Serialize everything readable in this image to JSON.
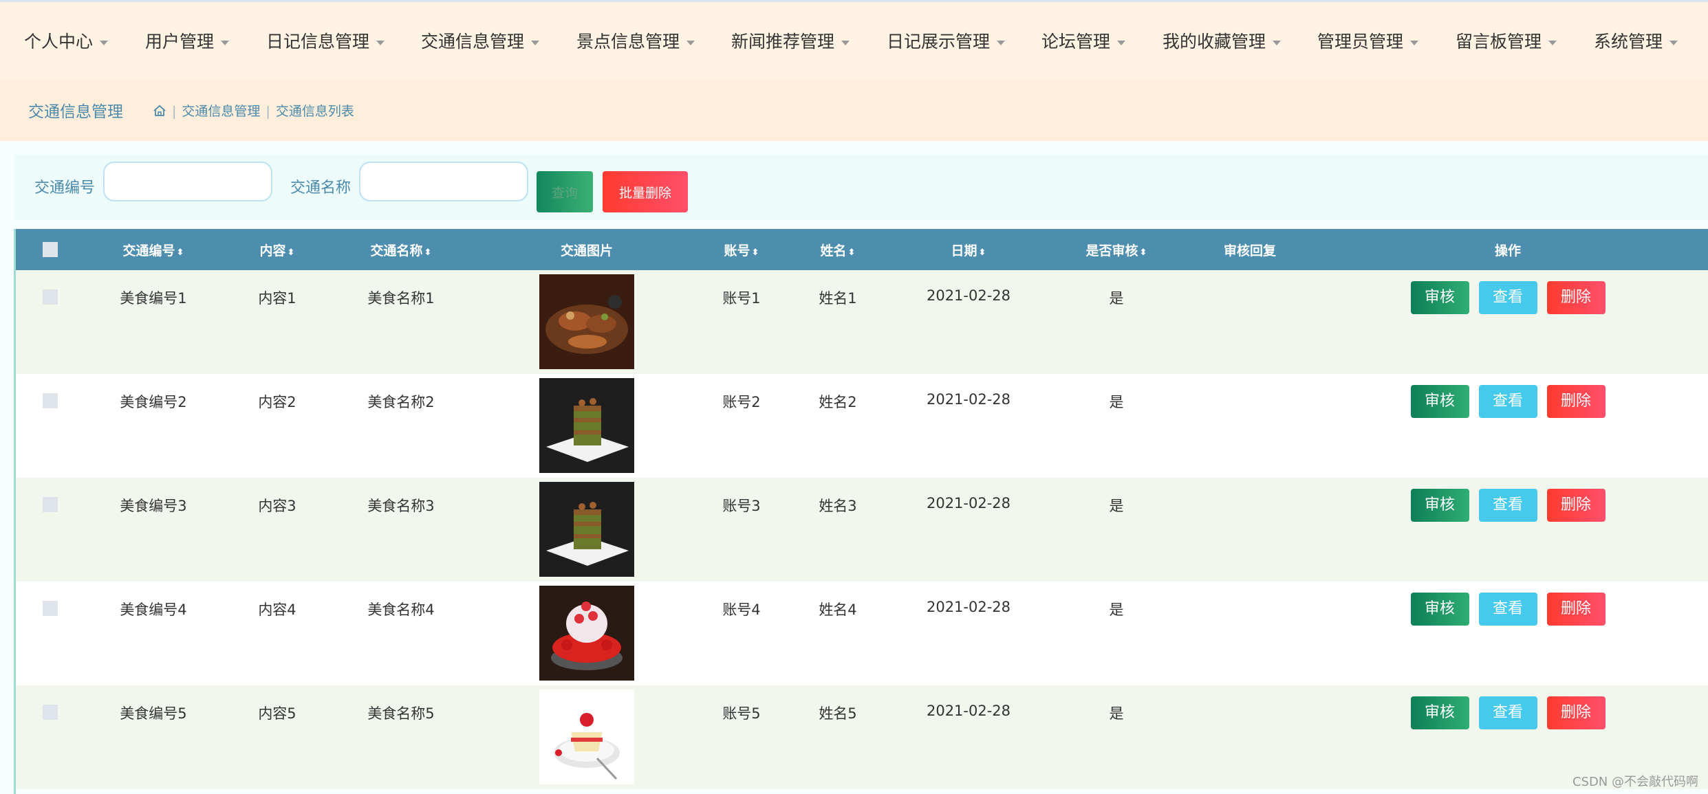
{
  "nav": {
    "items": [
      {
        "label": "个人中心"
      },
      {
        "label": "用户管理"
      },
      {
        "label": "日记信息管理"
      },
      {
        "label": "交通信息管理"
      },
      {
        "label": "景点信息管理"
      },
      {
        "label": "新闻推荐管理"
      },
      {
        "label": "日记展示管理"
      },
      {
        "label": "论坛管理"
      },
      {
        "label": "我的收藏管理"
      },
      {
        "label": "管理员管理"
      },
      {
        "label": "留言板管理"
      },
      {
        "label": "系统管理"
      }
    ]
  },
  "breadcrumb": {
    "title": "交通信息管理",
    "path": [
      "交通信息管理",
      "交通信息列表"
    ],
    "home_icon": "home-icon"
  },
  "search": {
    "field1_label": "交通编号",
    "field1_value": "",
    "field2_label": "交通名称",
    "field2_value": "",
    "search_button": "查询",
    "batch_delete_button": "批量删除"
  },
  "table": {
    "headers": {
      "code": "交通编号",
      "content": "内容",
      "name": "交通名称",
      "image": "交通图片",
      "account": "账号",
      "person": "姓名",
      "date": "日期",
      "audited": "是否审核",
      "reply": "审核回复",
      "ops": "操作"
    },
    "sort_icon": "sort-icon",
    "rows": [
      {
        "code": "美食编号1",
        "content": "内容1",
        "name": "美食名称1",
        "account": "账号1",
        "person": "姓名1",
        "date": "2021-02-28",
        "audited": "是",
        "reply": ""
      },
      {
        "code": "美食编号2",
        "content": "内容2",
        "name": "美食名称2",
        "account": "账号2",
        "person": "姓名2",
        "date": "2021-02-28",
        "audited": "是",
        "reply": ""
      },
      {
        "code": "美食编号3",
        "content": "内容3",
        "name": "美食名称3",
        "account": "账号3",
        "person": "姓名3",
        "date": "2021-02-28",
        "audited": "是",
        "reply": ""
      },
      {
        "code": "美食编号4",
        "content": "内容4",
        "name": "美食名称4",
        "account": "账号4",
        "person": "姓名4",
        "date": "2021-02-28",
        "audited": "是",
        "reply": ""
      },
      {
        "code": "美食编号5",
        "content": "内容5",
        "name": "美食名称5",
        "account": "账号5",
        "person": "姓名5",
        "date": "2021-02-28",
        "audited": "是",
        "reply": ""
      }
    ],
    "actions": {
      "audit": "审核",
      "view": "查看",
      "delete": "删除"
    }
  },
  "colors": {
    "header_bg": "#4d8dae",
    "nav_bg": "#fff3e3",
    "audit_btn": "#13875e",
    "view_btn": "#45c9ec",
    "delete_btn": "#ff3b2f"
  },
  "watermark": "CSDN @不会敲代码啊"
}
